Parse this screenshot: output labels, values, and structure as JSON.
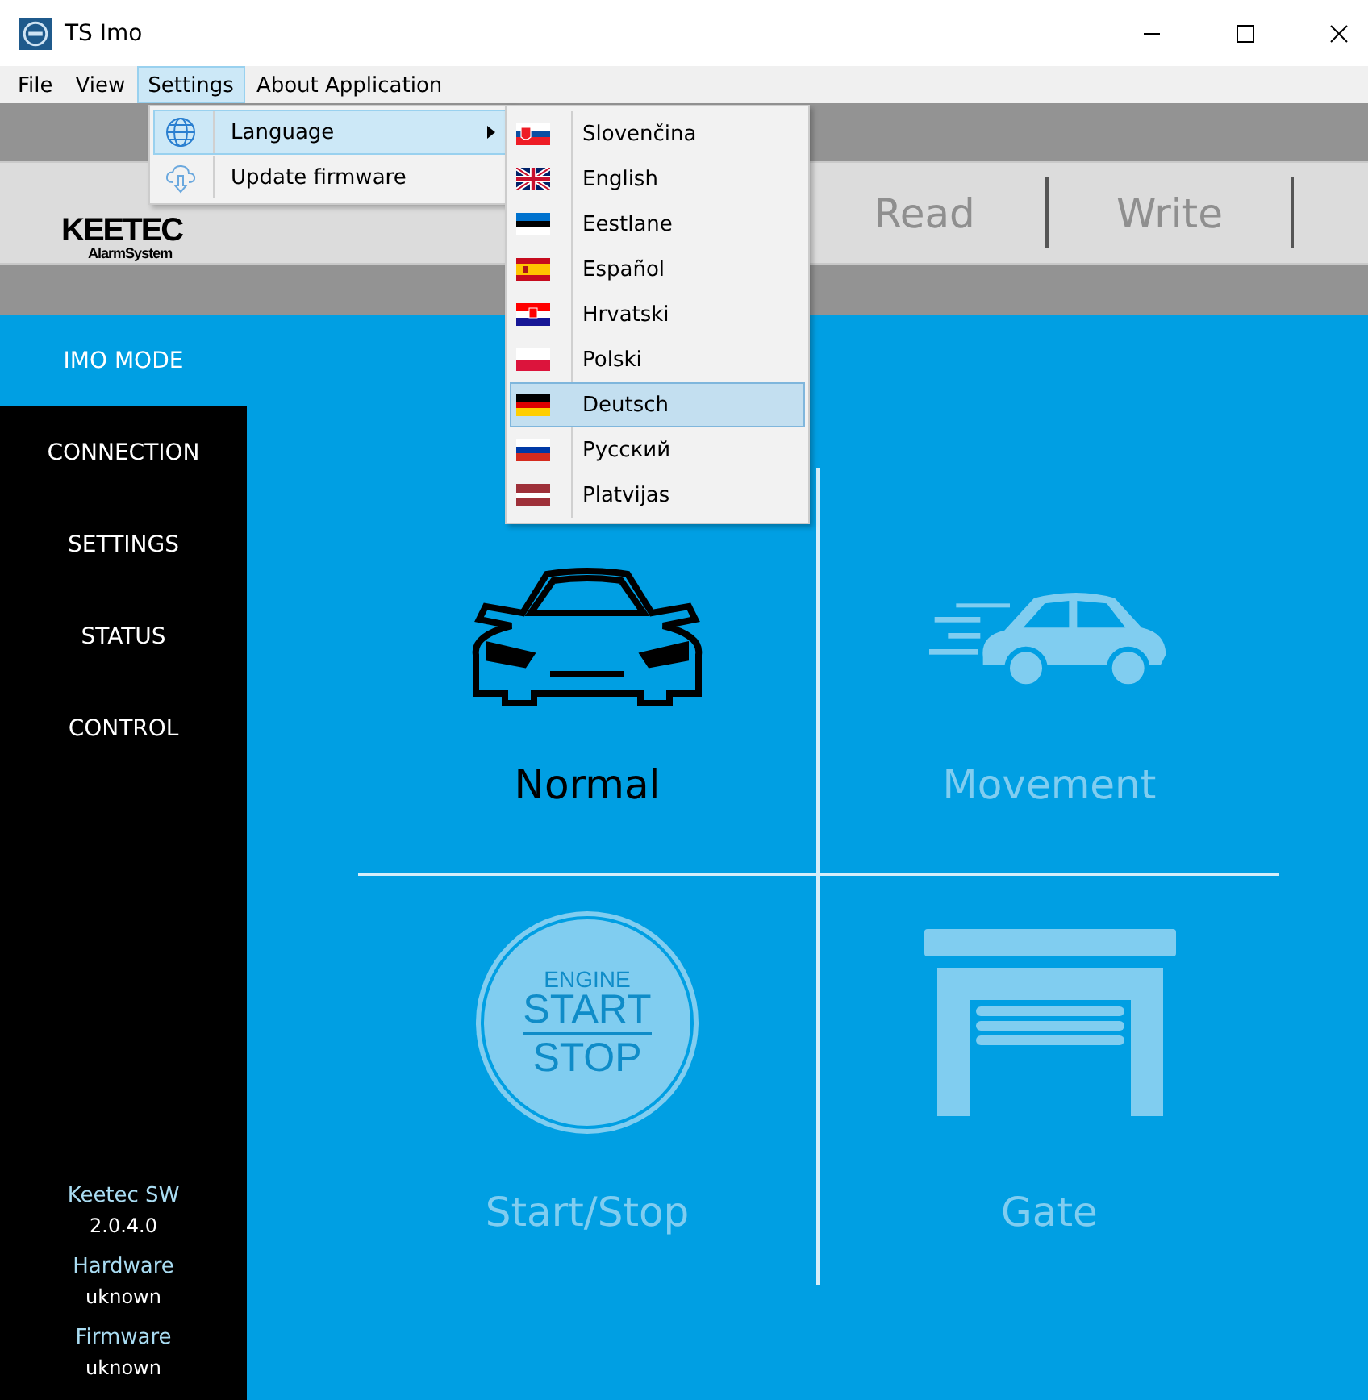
{
  "window": {
    "title": "TS Imo"
  },
  "menu_bar": [
    {
      "label": "File",
      "selected": false
    },
    {
      "label": "View",
      "selected": false
    },
    {
      "label": "Settings",
      "selected": true
    },
    {
      "label": "About Application",
      "selected": false
    }
  ],
  "settings_menu": [
    {
      "label": "Language",
      "kind": "globe",
      "selected": true,
      "submenu": true
    },
    {
      "label": "Update firmware",
      "kind": "cloud",
      "selected": false,
      "submenu": false
    }
  ],
  "language_menu": [
    {
      "label": "Slovenčina",
      "kind": "sk",
      "selected": false
    },
    {
      "label": "English",
      "kind": "gb",
      "selected": false
    },
    {
      "label": "Eestlane",
      "kind": "ee",
      "selected": false
    },
    {
      "label": "Español",
      "kind": "es",
      "selected": false
    },
    {
      "label": "Hrvatski",
      "kind": "hr",
      "selected": false
    },
    {
      "label": "Polski",
      "kind": "pl",
      "selected": false
    },
    {
      "label": "Deutsch",
      "kind": "de",
      "selected": true
    },
    {
      "label": "Русский",
      "kind": "ru",
      "selected": false
    },
    {
      "label": "Platvijas",
      "kind": "lv",
      "selected": false
    }
  ],
  "logo": {
    "name": "KEETEC",
    "tagline": "AlarmSystem"
  },
  "toolbar": [
    {
      "label": "Read",
      "disabled": true
    },
    {
      "label": "Write",
      "disabled": true
    }
  ],
  "sidebar": {
    "items": [
      {
        "label": "IMO MODE",
        "selected": true
      },
      {
        "label": "CONNECTION",
        "selected": false
      },
      {
        "label": "SETTINGS",
        "selected": false
      },
      {
        "label": "STATUS",
        "selected": false
      },
      {
        "label": "CONTROL",
        "selected": false
      }
    ],
    "info": [
      {
        "label": "Keetec SW",
        "value": "2.0.4.0"
      },
      {
        "label": "Hardware",
        "value": "uknown"
      },
      {
        "label": "Firmware",
        "value": "uknown"
      }
    ]
  },
  "modes": [
    {
      "label": "Normal",
      "kind": "car-front",
      "selected": true
    },
    {
      "label": "Movement",
      "kind": "car-moving",
      "selected": false
    },
    {
      "label": "Start/Stop",
      "kind": "engine-button",
      "selected": false,
      "icon_text": [
        "ENGINE",
        "START",
        "STOP"
      ]
    },
    {
      "label": "Gate",
      "kind": "garage",
      "selected": false
    }
  ]
}
